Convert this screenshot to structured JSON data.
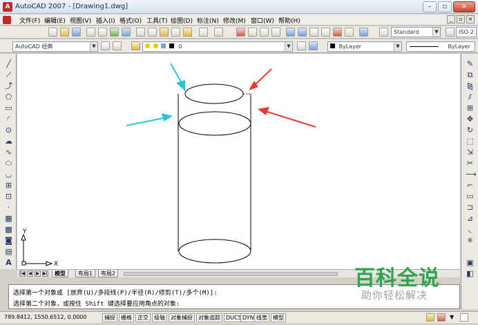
{
  "window": {
    "title": "AutoCAD 2007 - [Drawing1.dwg]",
    "app_icon": "autocad-logo-icon",
    "controls": [
      "–",
      "▫",
      "×"
    ]
  },
  "menu": {
    "items": [
      "文件(F)",
      "编辑(E)",
      "视图(V)",
      "插入(I)",
      "格式(O)",
      "工具(T)",
      "绘图(D)",
      "标注(N)",
      "修改(M)",
      "窗口(W)",
      "帮助(H)"
    ],
    "doc_controls": [
      "_",
      "▫",
      "×"
    ]
  },
  "toolbar": {
    "text_style": "Standard",
    "dim_style": "ISO-2"
  },
  "layers": {
    "workspace": "AutoCAD 经典",
    "current_layer": "0",
    "color": "ByLayer",
    "linetype": "ByLayer"
  },
  "ucs": {
    "x_label": "X",
    "y_label": "Y"
  },
  "tabs": {
    "model": "模型",
    "layout1": "布局1",
    "layout2": "布局2"
  },
  "command": {
    "line1": "选择第一个对象或 [放弃(U)/多段线(P)/半径(R)/修剪(T)/多个(M)]:",
    "line2": "选择第二个对象，或按住 Shift 键选择要应用角点的对象:"
  },
  "status": {
    "coords": "789.8412,  1550.6512, 0.0000",
    "buttons": [
      "捕捉",
      "栅格",
      "正交",
      "极轴",
      "对象捕捉",
      "对象追踪",
      "DUCS",
      "DYN",
      "线宽",
      "模型"
    ]
  },
  "watermark": {
    "title": "百科全说",
    "subtitle": "助你轻松解决"
  },
  "colors": {
    "arrow_cyan": "#26c6da",
    "arrow_red": "#e53935",
    "watermark_green": "#2ea44f"
  }
}
